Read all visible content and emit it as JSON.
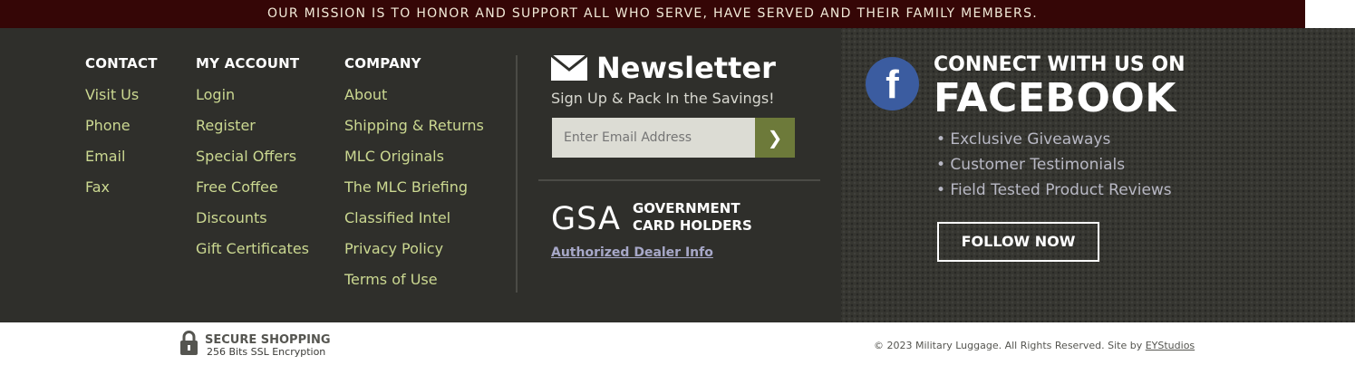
{
  "mission": "OUR MISSION IS TO HONOR AND SUPPORT ALL WHO SERVE, HAVE SERVED AND THEIR FAMILY MEMBERS.",
  "contact": {
    "heading": "CONTACT",
    "links": [
      "Visit Us",
      "Phone",
      "Email",
      "Fax"
    ]
  },
  "account": {
    "heading": "MY ACCOUNT",
    "links": [
      "Login",
      "Register",
      "Special Offers",
      "Free Coffee",
      "Discounts",
      "Gift Certificates"
    ]
  },
  "company": {
    "heading": "COMPANY",
    "links": [
      "About",
      "Shipping & Returns",
      "MLC Originals",
      "The MLC Briefing",
      "Classified Intel",
      "Privacy Policy",
      "Terms of Use"
    ]
  },
  "newsletter": {
    "title": "Newsletter",
    "subtitle": "Sign Up & Pack In the Savings!",
    "placeholder": "Enter Email Address",
    "submit_glyph": "❯",
    "icon": "envelope-icon"
  },
  "gsa": {
    "logo": "GSA",
    "line1": "GOVERNMENT",
    "line2": "CARD HOLDERS",
    "link": "Authorized Dealer Info"
  },
  "facebook": {
    "icon_glyph": "f",
    "pre": "CONNECT WITH US ON",
    "big": "FACEBOOK",
    "bullets": [
      "• Exclusive Giveaways",
      "• Customer Testimonials",
      "• Field Tested Product Reviews"
    ],
    "button": "FOLLOW NOW"
  },
  "bottom": {
    "secure_title": "SECURE SHOPPING",
    "secure_sub": "256 Bits SSL Encryption",
    "copyright": "© 2023 Military Luggage. All Rights Reserved. Site by ",
    "credit_link": "EYStudios",
    "icon": "lock-icon"
  },
  "colors": {
    "mission_bg": "#350606",
    "footer_bg": "#2f2f2b",
    "link": "#cbd891",
    "accent_button": "#6d7a3a",
    "facebook_blue": "#3b5ca0"
  }
}
